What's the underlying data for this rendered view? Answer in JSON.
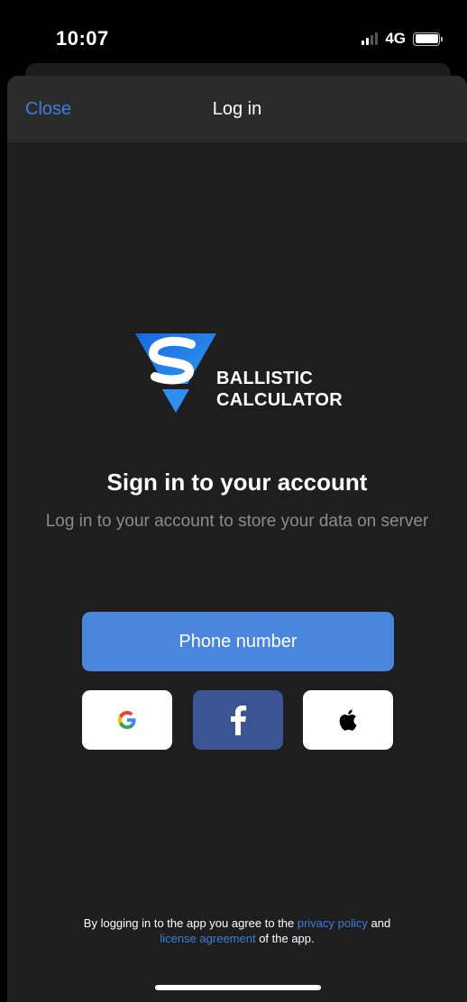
{
  "status_bar": {
    "time": "10:07",
    "network": "4G",
    "signal_bars_active": 2,
    "signal_bars_total": 4,
    "battery_level": 1.0
  },
  "nav": {
    "close_label": "Close",
    "title": "Log in"
  },
  "logo": {
    "line1": "BALLISTIC",
    "line2": "CALCULATOR",
    "icon": "ballistic-shield-icon"
  },
  "content": {
    "headline": "Sign in to your account",
    "subtext": "Log in to your account to store your data on server"
  },
  "buttons": {
    "phone_label": "Phone number",
    "google_icon": "google-icon",
    "facebook_icon": "facebook-icon",
    "apple_icon": "apple-icon"
  },
  "legal": {
    "prefix": "By logging in to the app you agree to the ",
    "privacy_link": "privacy policy",
    "middle": " and ",
    "license_link": "license agreement",
    "suffix": " of the app."
  },
  "colors": {
    "accent": "#3a7ee0",
    "primary_button": "#4a86dd",
    "facebook": "#3a5494",
    "background": "#1e1e1e",
    "nav_background": "#2b2b2b"
  }
}
